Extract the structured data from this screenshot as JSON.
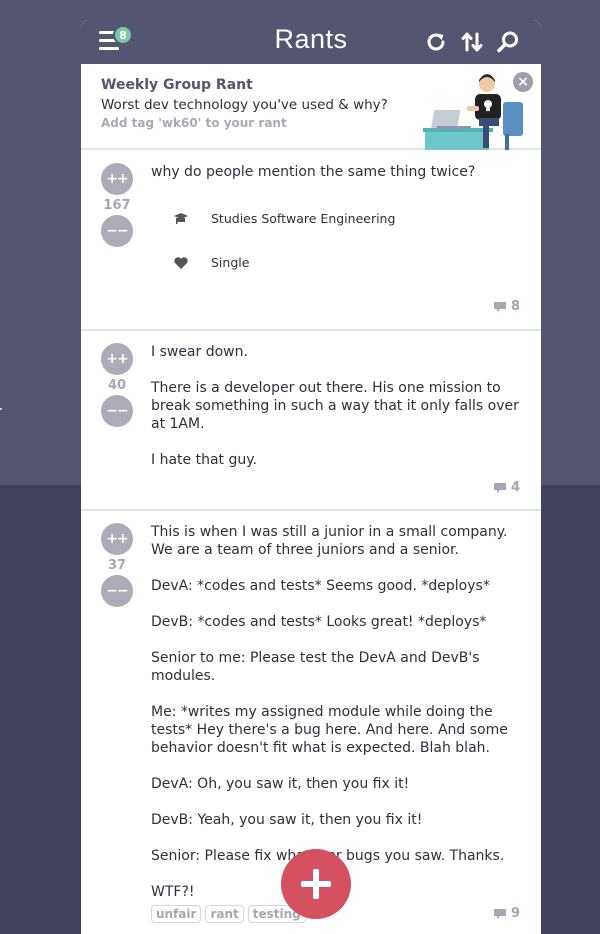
{
  "header": {
    "title": "Rants",
    "notification_count": "8",
    "icons": [
      "menu-icon",
      "refresh-icon",
      "sort-icon",
      "search-icon"
    ]
  },
  "weekly": {
    "title": "Weekly Group Rant",
    "question": "Worst dev technology you've used & why?",
    "tag_hint": "Add tag 'wk60' to your rant",
    "close_label": "×"
  },
  "rants": [
    {
      "score": "167",
      "upvote_label": "++",
      "downvote_label": "−−",
      "paragraphs": [
        "why do people mention the same thing twice?"
      ],
      "attributes": [
        {
          "icon": "graduation-cap-icon",
          "text": "Studies Software Engineering"
        },
        {
          "icon": "heart-icon",
          "text": "Single"
        }
      ],
      "comments": "8",
      "tags": []
    },
    {
      "score": "40",
      "upvote_label": "++",
      "downvote_label": "−−",
      "paragraphs": [
        "I swear down.",
        "There is a developer out there. His one mission to break something in such a way that it only falls over at 1AM.",
        "I hate that guy."
      ],
      "comments": "4",
      "tags": []
    },
    {
      "score": "37",
      "upvote_label": "++",
      "downvote_label": "−−",
      "paragraphs": [
        "This is when I was still a junior in a small company. We are a team of three juniors and a senior.",
        "DevA: *codes and tests* Seems good. *deploys*",
        "DevB: *codes and tests* Looks great! *deploys*",
        "Senior to me: Please test the DevA and DevB's modules.",
        "Me: *writes my assigned module while doing the tests* Hey there's a bug here. And here. And some behavior doesn't fit what is expected. Blah blah.",
        "DevA: Oh, you saw it, then you fix it!",
        "DevB: Yeah, you saw it, then you fix it!",
        "Senior: Please fix whatever bugs you saw. Thanks.",
        "WTF?!"
      ],
      "comments": "9",
      "tags": [
        "unfair",
        "rant",
        "testing"
      ]
    }
  ],
  "fab": {
    "icon": "plus-icon"
  },
  "colors": {
    "header_bg": "#54556f",
    "vote_button": "#abacb7",
    "fab": "#d55161",
    "badge": "#7bc8a4"
  }
}
